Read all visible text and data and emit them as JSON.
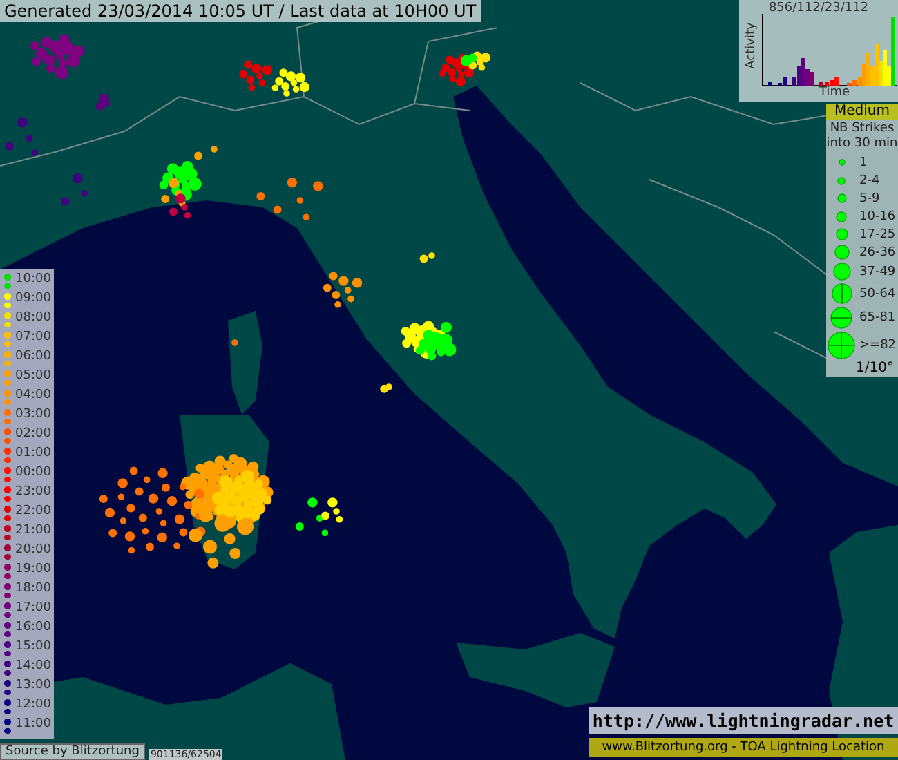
{
  "header": {
    "text": "Generated 23/03/2014 10:05 UT / Last data at 10H00 UT"
  },
  "activity_chart": {
    "title": "856/112/23/112",
    "ylabel": "Activity",
    "xlabel": "Time"
  },
  "strike_legend": {
    "level": "Medium",
    "title": "NB Strikes into 30 min",
    "scale": "1/10°",
    "items": [
      {
        "label": "1",
        "kind": "dot"
      },
      {
        "label": "2-4",
        "kind": "dot"
      },
      {
        "label": "5-9",
        "kind": "dot"
      },
      {
        "label": "10-16",
        "kind": "dot"
      },
      {
        "label": "17-25",
        "kind": "dot"
      },
      {
        "label": "26-36",
        "kind": "dot"
      },
      {
        "label": "37-49",
        "kind": "dot"
      },
      {
        "label": "50-64",
        "kind": "vline"
      },
      {
        "label": "65-81",
        "kind": "hline"
      },
      {
        "label": ">=82",
        "kind": "cross"
      }
    ]
  },
  "time_legend": [
    {
      "label": "10:00",
      "color": "#00e000"
    },
    {
      "label": "09:00",
      "color": "#ffff00"
    },
    {
      "label": "08:00",
      "color": "#f0e000"
    },
    {
      "label": "07:00",
      "color": "#ffc000"
    },
    {
      "label": "06:00",
      "color": "#ffb000"
    },
    {
      "label": "05:00",
      "color": "#ffa000"
    },
    {
      "label": "04:00",
      "color": "#ff9000"
    },
    {
      "label": "03:00",
      "color": "#ff7000"
    },
    {
      "label": "02:00",
      "color": "#ff5000"
    },
    {
      "label": "01:00",
      "color": "#ff3000"
    },
    {
      "label": "00:00",
      "color": "#ff1000"
    },
    {
      "label": "23:00",
      "color": "#ff0000"
    },
    {
      "label": "22:00",
      "color": "#e00000"
    },
    {
      "label": "21:00",
      "color": "#c00020"
    },
    {
      "label": "20:00",
      "color": "#a00040"
    },
    {
      "label": "19:00",
      "color": "#900060"
    },
    {
      "label": "18:00",
      "color": "#800070"
    },
    {
      "label": "17:00",
      "color": "#700080"
    },
    {
      "label": "16:00",
      "color": "#600080"
    },
    {
      "label": "15:00",
      "color": "#500080"
    },
    {
      "label": "14:00",
      "color": "#400080"
    },
    {
      "label": "13:00",
      "color": "#200080"
    },
    {
      "label": "12:00",
      "color": "#100080"
    },
    {
      "label": "11:00",
      "color": "#000080"
    }
  ],
  "source": "Source by Blitzortung",
  "counter": "901136/62504",
  "url": "http://www.lightningradar.net",
  "footer": "www.Blitzortung.org - TOA Lightning Location"
}
